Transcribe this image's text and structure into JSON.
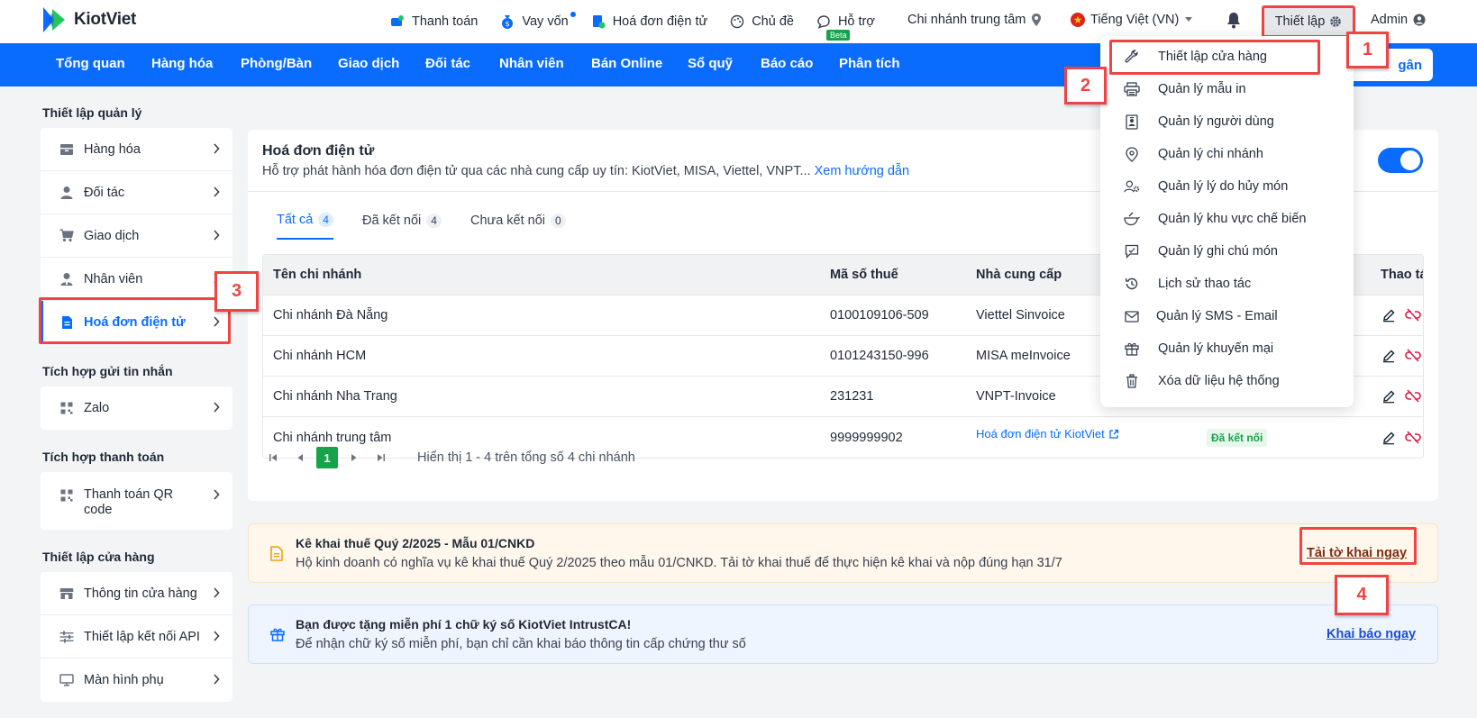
{
  "brand": {
    "name": "KiotViet"
  },
  "topnav": {
    "items": [
      {
        "label": "Thanh toán",
        "icon": "payment-icon"
      },
      {
        "label": "Vay vốn",
        "icon": "money-bag-icon"
      },
      {
        "label": "Hoá đơn điện tử",
        "icon": "invoice-icon"
      },
      {
        "label": "Chủ đề",
        "icon": "palette-icon"
      },
      {
        "label": "Hỗ trợ",
        "icon": "chat-icon",
        "badge": "Beta"
      }
    ],
    "branch": "Chi nhánh trung tâm",
    "language": "Tiếng Việt (VN)",
    "setup": "Thiết lập",
    "user": "Admin"
  },
  "mainnav": {
    "items": [
      "Tổng quan",
      "Hàng hóa",
      "Phòng/Bàn",
      "Giao dịch",
      "Đối tác",
      "Nhân viên",
      "Bán Online",
      "Sổ quỹ",
      "Báo cáo",
      "Phân tích"
    ],
    "action_label": "gân"
  },
  "sidebar": {
    "groups": [
      {
        "title": "Thiết lập quản lý",
        "items": [
          {
            "label": "Hàng hóa",
            "icon": "box-icon"
          },
          {
            "label": "Đối tác",
            "icon": "person-icon"
          },
          {
            "label": "Giao dịch",
            "icon": "cart-icon"
          },
          {
            "label": "Nhân viên",
            "icon": "staff-icon"
          },
          {
            "label": "Hoá đơn điện tử",
            "icon": "document-icon",
            "active": true
          }
        ]
      },
      {
        "title": "Tích hợp gửi tin nhắn",
        "items": [
          {
            "label": "Zalo",
            "icon": "qr-icon"
          }
        ]
      },
      {
        "title": "Tích hợp thanh toán",
        "items": [
          {
            "label": "Thanh toán QR code",
            "icon": "qr-icon"
          }
        ]
      },
      {
        "title": "Thiết lập cửa hàng",
        "items": [
          {
            "label": "Thông tin cửa hàng",
            "icon": "store-icon"
          },
          {
            "label": "Thiết lập kết nối API",
            "icon": "sliders-icon"
          },
          {
            "label": "Màn hình phụ",
            "icon": "monitor-icon"
          }
        ]
      }
    ]
  },
  "einvoice": {
    "title": "Hoá đơn điện tử",
    "subtitle": "Hỗ trợ phát hành hóa đơn điện tử qua các nhà cung cấp uy tín: KiotViet, MISA, Viettel, VNPT...",
    "guide_link": "Xem hướng dẫn",
    "enabled": true,
    "tabs": [
      {
        "label": "Tất cả",
        "count": "4"
      },
      {
        "label": "Đã kết nối",
        "count": "4"
      },
      {
        "label": "Chưa kết nối",
        "count": "0"
      }
    ],
    "columns": [
      "Tên chi nhánh",
      "Mã số thuế",
      "Nhà cung cấp",
      "Thao tác"
    ],
    "rows": [
      {
        "branch": "Chi nhánh Đà Nẵng",
        "tax": "0100109106-509",
        "provider": "Viettel Sinvoice"
      },
      {
        "branch": "Chi nhánh HCM",
        "tax": "0101243150-996",
        "provider": "MISA meInvoice"
      },
      {
        "branch": "Chi nhánh Nha Trang",
        "tax": "231231",
        "provider": "VNPT-Invoice"
      },
      {
        "branch": "Chi nhánh trung tâm",
        "tax": "9999999902",
        "provider": "Hoá đơn điện tử KiotViet",
        "status": "Đã kết nối"
      }
    ],
    "pager": {
      "current": "1",
      "summary": "Hiển thị 1 - 4 trên tổng số 4 chi nhánh"
    }
  },
  "banners": {
    "tax": {
      "title": "Kê khai thuế Quý 2/2025 - Mẫu 01/CNKD",
      "text": "Hộ kinh doanh có nghĩa vụ kê khai thuế Quý 2/2025 theo mẫu 01/CNKD. Tải tờ khai thuế để thực hiện kê khai và nộp đúng hạn 31/7",
      "link": "Tải tờ khai ngay"
    },
    "signature": {
      "title": "Bạn được tặng miễn phí 1 chữ ký số KiotViet IntrustCA!",
      "text": "Để nhận chữ ký số miễn phí, bạn chỉ cần khai báo thông tin cấp chứng thư số",
      "link": "Khai báo ngay"
    }
  },
  "setup_menu": {
    "items": [
      {
        "label": "Thiết lập cửa hàng",
        "icon": "wrench-icon"
      },
      {
        "label": "Quản lý mẫu in",
        "icon": "printer-icon"
      },
      {
        "label": "Quản lý người dùng",
        "icon": "user-badge-icon"
      },
      {
        "label": "Quản lý chi nhánh",
        "icon": "location-icon"
      },
      {
        "label": "Quản lý lý do hủy món",
        "icon": "user-gear-icon"
      },
      {
        "label": "Quản lý khu vực chế biến",
        "icon": "cooking-icon"
      },
      {
        "label": "Quản lý ghi chú món",
        "icon": "note-icon"
      },
      {
        "label": "Lịch sử thao tác",
        "icon": "history-icon"
      },
      {
        "label": "Quản lý SMS - Email",
        "icon": "mail-icon"
      },
      {
        "label": "Quản lý khuyến mại",
        "icon": "gift-icon"
      },
      {
        "label": "Xóa dữ liệu hệ thống",
        "icon": "trash-icon"
      }
    ]
  },
  "annotations": [
    "1",
    "2",
    "3",
    "4"
  ],
  "colors": {
    "primary": "#0a6cff",
    "success": "#16a34a",
    "callout": "#ef4444",
    "danger": "#e11d48"
  }
}
